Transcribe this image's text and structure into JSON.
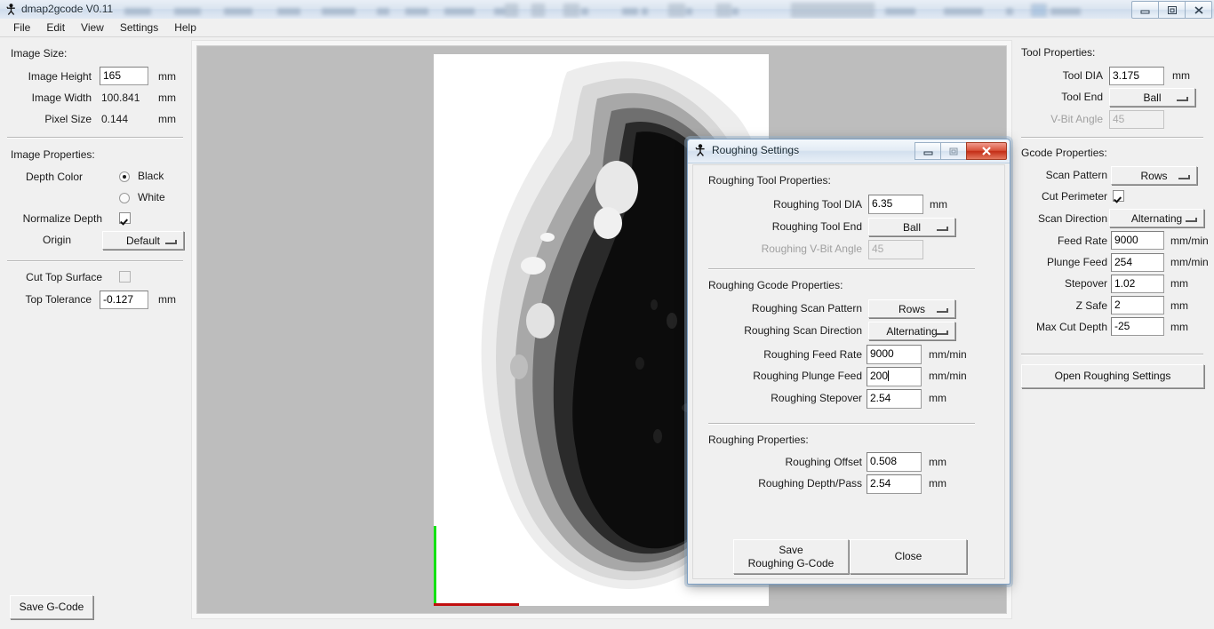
{
  "window": {
    "title": "dmap2gcode V0.11",
    "icon": "tk-figure-icon",
    "controls": {
      "minimize": "–",
      "restore": "❐",
      "close": "✕"
    }
  },
  "menubar": {
    "items": [
      {
        "label": "File"
      },
      {
        "label": "Edit"
      },
      {
        "label": "View"
      },
      {
        "label": "Settings"
      },
      {
        "label": "Help"
      }
    ]
  },
  "left_panel": {
    "image_size": {
      "group_label": "Image Size:",
      "image_height": {
        "label": "Image Height",
        "value": "165",
        "units": "mm"
      },
      "image_width": {
        "label": "Image Width",
        "value": "100.841",
        "units": "mm"
      },
      "pixel_size": {
        "label": "Pixel Size",
        "value": "0.144",
        "units": "mm"
      }
    },
    "image_properties": {
      "group_label": "Image Properties:",
      "depth_color": {
        "label": "Depth Color",
        "options": [
          "Black",
          "White"
        ],
        "selected": "Black"
      },
      "normalize_depth": {
        "label": "Normalize Depth",
        "checked": true
      },
      "origin": {
        "label": "Origin",
        "value": "Default"
      }
    },
    "cut_options": {
      "cut_top_surface": {
        "label": "Cut Top Surface",
        "checked": false
      },
      "top_tolerance": {
        "label": "Top Tolerance",
        "value": "-0.127",
        "units": "mm"
      }
    },
    "save_gcode_button": "Save G-Code"
  },
  "right_panel": {
    "tool_properties": {
      "group_label": "Tool Properties:",
      "tool_dia": {
        "label": "Tool DIA",
        "value": "3.175",
        "units": "mm"
      },
      "tool_end": {
        "label": "Tool End",
        "value": "Ball"
      },
      "v_bit_angle": {
        "label": "V-Bit Angle",
        "value": "45",
        "disabled": true
      }
    },
    "gcode_properties": {
      "group_label": "Gcode Properties:",
      "scan_pattern": {
        "label": "Scan Pattern",
        "value": "Rows"
      },
      "cut_perimeter": {
        "label": "Cut Perimeter",
        "checked": true
      },
      "scan_direction": {
        "label": "Scan Direction",
        "value": "Alternating"
      },
      "feed_rate": {
        "label": "Feed Rate",
        "value": "9000",
        "units": "mm/min"
      },
      "plunge_feed": {
        "label": "Plunge Feed",
        "value": "254",
        "units": "mm/min"
      },
      "stepover": {
        "label": "Stepover",
        "value": "1.02",
        "units": "mm"
      },
      "z_safe": {
        "label": "Z Safe",
        "value": "2",
        "units": "mm"
      },
      "max_cut_depth": {
        "label": "Max Cut Depth",
        "value": "-25",
        "units": "mm"
      }
    },
    "open_roughing_settings_button": "Open Roughing Settings"
  },
  "dialog": {
    "title": "Roughing Settings",
    "icon": "tk-figure-icon",
    "controls": {
      "minimize": "–",
      "restore": "❐",
      "close": "✕"
    },
    "tool_properties": {
      "group_label": "Roughing Tool Properties:",
      "tool_dia": {
        "label": "Roughing Tool DIA",
        "value": "6.35",
        "units": "mm"
      },
      "tool_end": {
        "label": "Roughing Tool End",
        "value": "Ball"
      },
      "v_bit_angle": {
        "label": "Roughing V-Bit Angle",
        "value": "45",
        "disabled": true
      }
    },
    "gcode_properties": {
      "group_label": "Roughing Gcode Properties:",
      "scan_pattern": {
        "label": "Roughing Scan Pattern",
        "value": "Rows"
      },
      "scan_direction": {
        "label": "Roughing Scan Direction",
        "value": "Alternating"
      },
      "feed_rate": {
        "label": "Roughing Feed Rate",
        "value": "9000",
        "units": "mm/min"
      },
      "plunge_feed": {
        "label": "Roughing Plunge Feed",
        "value": "200",
        "units": "mm/min",
        "focused": true
      },
      "stepover": {
        "label": "Roughing Stepover",
        "value": "2.54",
        "units": "mm"
      }
    },
    "roughing_properties": {
      "group_label": "Roughing Properties:",
      "offset": {
        "label": "Roughing Offset",
        "value": "0.508",
        "units": "mm"
      },
      "depth_per_pass": {
        "label": "Roughing Depth/Pass",
        "value": "2.54",
        "units": "mm"
      }
    },
    "buttons": {
      "save": "Save\nRoughing G-Code",
      "save_line1": "Save",
      "save_line2": "Roughing G-Code",
      "close": "Close"
    }
  },
  "canvas": {
    "background_color": "#bdbdbd",
    "image_background": "#ffffff",
    "x_axis_color": "#c10f0f",
    "y_axis_color": "#13e113",
    "description": "grayscale depth-map contour preview"
  }
}
